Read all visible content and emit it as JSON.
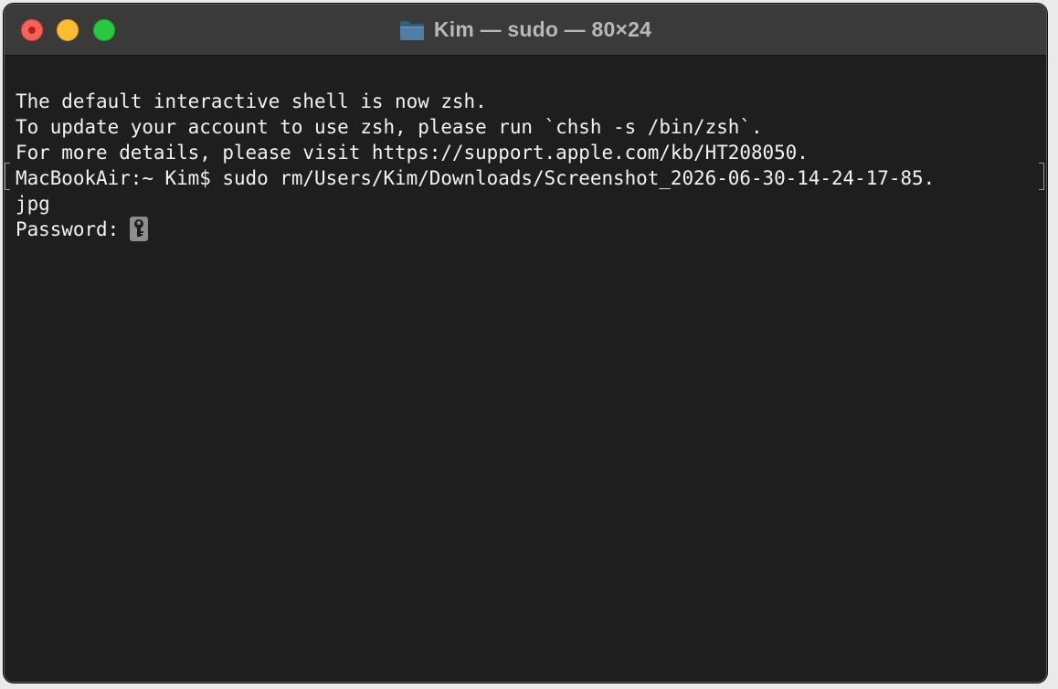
{
  "window": {
    "title": "Kim — sudo — 80×24"
  },
  "traffic_lights": {
    "close": "close",
    "minimize": "minimize",
    "zoom": "zoom"
  },
  "terminal": {
    "lines": [
      "The default interactive shell is now zsh.",
      "To update your account to use zsh, please run `chsh -s /bin/zsh`.",
      "For more details, please visit https://support.apple.com/kb/HT208050.",
      "MacBookAir:~ Kim$ sudo rm/Users/Kim/Downloads/Screenshot_2026-06-30-14-24-17-85.",
      "jpg",
      "Password:"
    ],
    "cursor_icon": "key-icon"
  },
  "colors": {
    "titlebar": "#3a3a3a",
    "terminal_background": "#1e1e1e",
    "terminal_text": "#f2f2f2",
    "close": "#fe5f57",
    "minimize": "#febc2e",
    "zoom": "#28c840",
    "folder": "#4f7fa7"
  }
}
